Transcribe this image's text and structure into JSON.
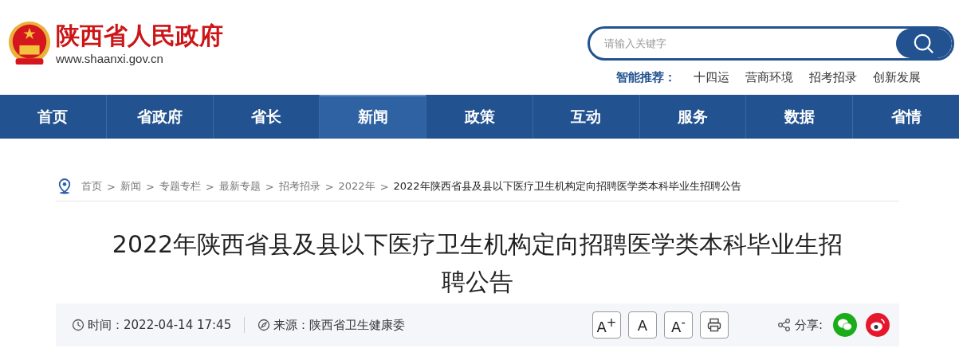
{
  "site": {
    "name": "陕西省人民政府",
    "url": "www.shaanxi.gov.cn"
  },
  "search": {
    "placeholder": "请输入关键字"
  },
  "recommend": {
    "label": "智能推荐：",
    "links": [
      "十四运",
      "营商环境",
      "招考招录",
      "创新发展"
    ]
  },
  "nav": [
    {
      "label": "首页",
      "selected": false
    },
    {
      "label": "省政府",
      "selected": false
    },
    {
      "label": "省长",
      "selected": false
    },
    {
      "label": "新闻",
      "selected": true
    },
    {
      "label": "政策",
      "selected": false
    },
    {
      "label": "互动",
      "selected": false
    },
    {
      "label": "服务",
      "selected": false
    },
    {
      "label": "数据",
      "selected": false
    },
    {
      "label": "省情",
      "selected": false
    }
  ],
  "breadcrumb": {
    "separator": ">",
    "items": [
      {
        "label": "首页",
        "current": false
      },
      {
        "label": "新闻",
        "current": false
      },
      {
        "label": "专题专栏",
        "current": false
      },
      {
        "label": "最新专题",
        "current": false
      },
      {
        "label": "招考招录",
        "current": false
      },
      {
        "label": "2022年",
        "current": false
      },
      {
        "label": "2022年陕西省县及县以下医疗卫生机构定向招聘医学类本科毕业生招聘公告",
        "current": true
      }
    ]
  },
  "article": {
    "title": "2022年陕西省县及县以下医疗卫生机构定向招聘医学类本科毕业生招聘公告",
    "time": "时间：2022-04-14 17:45",
    "source": "来源：陕西省卫生健康委",
    "font_buttons": [
      {
        "kind": "larger",
        "label": "A$^{+}$"
      },
      {
        "kind": "normal",
        "label": "A"
      },
      {
        "kind": "smaller",
        "label": "A$^{-}$"
      },
      {
        "kind": "print"
      }
    ],
    "share_label": "分享:",
    "share": [
      {
        "kind": "wechat",
        "color": "#1aad19"
      },
      {
        "kind": "weibo",
        "color": "#e6162d"
      }
    ]
  }
}
